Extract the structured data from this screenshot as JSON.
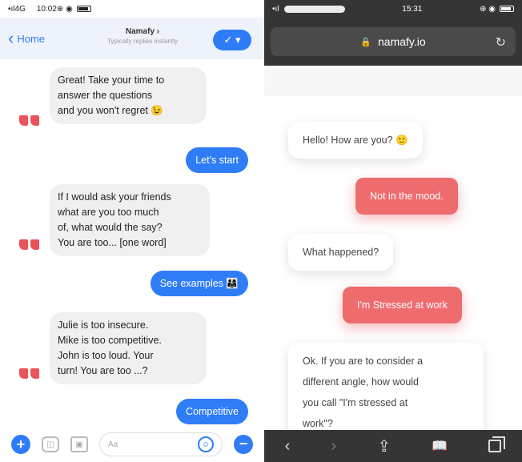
{
  "messenger": {
    "status": {
      "signal": "•ıl",
      "network": "4G",
      "time": "10:02",
      "icons": "⊕ ◉"
    },
    "header": {
      "back_label": "Home",
      "title": "Namafy ›",
      "subtitle": "Typically replies instantly",
      "video_icon": "✓ ▾"
    },
    "messages": [
      {
        "type": "in",
        "lines": [
          "Great! Take your time to",
          "answer the questions",
          "and you won't regret 😉"
        ]
      },
      {
        "type": "out",
        "text": "Let's start"
      },
      {
        "type": "in",
        "lines": [
          "If I would ask your friends",
          "what are you too much",
          "of, what would the say?",
          "You are too... [one word]"
        ]
      },
      {
        "type": "out",
        "text": "See examples 👨‍👩‍👧"
      },
      {
        "type": "in",
        "lines": [
          "Julie is too insecure.",
          "Mike is too competitive.",
          "John is too loud. Your",
          "turn! You are too ...?"
        ]
      },
      {
        "type": "out",
        "text": "Competitive"
      }
    ],
    "footer": {
      "plus": "+",
      "camera": "◫",
      "photo": "▣",
      "input_placeholder": "Aa",
      "emoji": "☺",
      "like": "−"
    }
  },
  "browser": {
    "status": {
      "time": "15:31",
      "icons": "⊕ ◉"
    },
    "url": "namafy.io",
    "lock_icon": "🔒",
    "reload_icon": "↻",
    "messages": [
      {
        "type": "in",
        "text": "Hello! How are you? 🙂"
      },
      {
        "type": "out",
        "text": "Not in the mood."
      },
      {
        "type": "in",
        "text": "What happened?"
      },
      {
        "type": "out",
        "text": "I'm Stressed at work"
      },
      {
        "type": "in",
        "lines": [
          "Ok. If you are to consider a",
          "different angle, how would",
          "you call \"I'm stressed at",
          "work\"?"
        ]
      }
    ],
    "toolbar": {
      "back": "‹",
      "forward": "›",
      "share": "⇪",
      "bookmarks": "📖",
      "tabs": ""
    }
  }
}
